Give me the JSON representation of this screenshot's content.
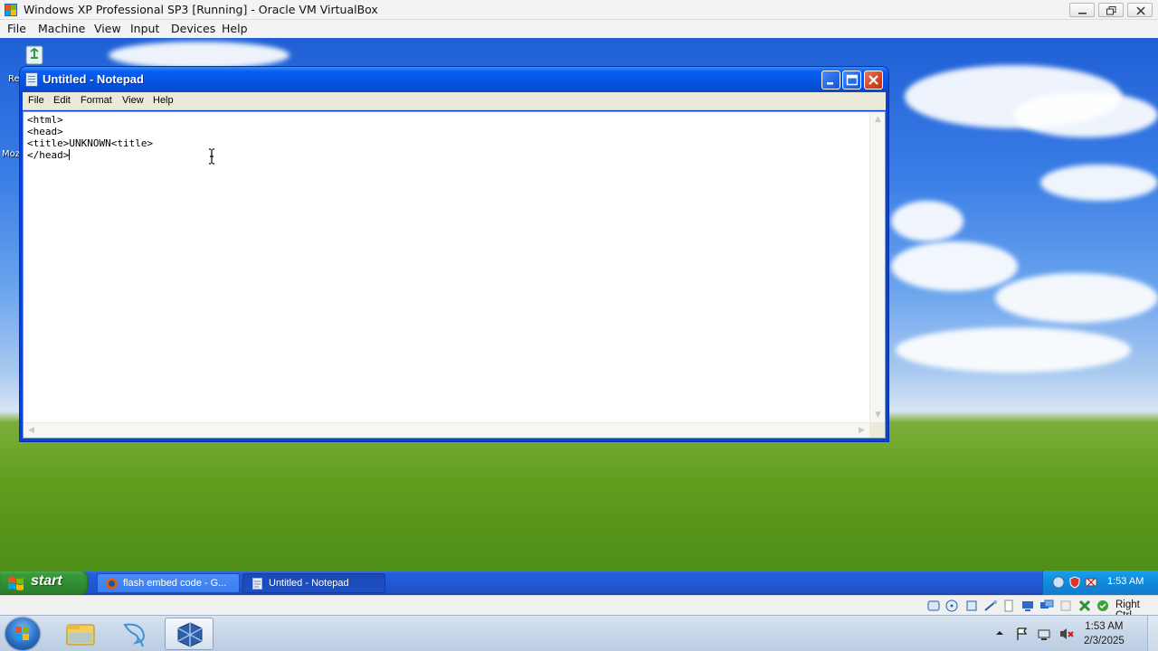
{
  "host_window": {
    "title": "Windows XP Professional SP3 [Running] - Oracle VM VirtualBox",
    "menu": [
      "File",
      "Machine",
      "View",
      "Input",
      "Devices",
      "Help"
    ],
    "status_bar": {
      "host_key_label": "Right Ctrl",
      "icons": [
        "hard-disk-icon",
        "optical-drive-icon",
        "audio-icon",
        "network-icon",
        "usb-icon",
        "shared-folders-icon",
        "display-icon",
        "video-capture-icon",
        "cpu-icon",
        "virtualization-icon",
        "mouse-integration-icon"
      ]
    }
  },
  "guest": {
    "desktop_fragments": [
      "Re",
      "Moz"
    ],
    "notepad": {
      "title": "Untitled - Notepad",
      "menu": [
        "File",
        "Edit",
        "Format",
        "View",
        "Help"
      ],
      "content_lines": [
        "<html>",
        "<head>",
        "<title>UNKNOWN<title>",
        "</head>"
      ]
    },
    "taskbar": {
      "start_label": "start",
      "tasks": [
        {
          "label": "flash embed code - G...",
          "icon": "firefox-icon",
          "active": false
        },
        {
          "label": "Untitled - Notepad",
          "icon": "notepad-icon",
          "active": true
        }
      ],
      "clock": "1:53 AM"
    }
  },
  "host_taskbar": {
    "time": "1:53 AM",
    "date": "2/3/2025",
    "pinned": [
      "windows-explorer-icon",
      "kali-linux-icon",
      "virtualbox-icon"
    ]
  },
  "colors": {
    "xp_titlebar": "#0554e3",
    "xp_close": "#d6431c",
    "xp_start": "#3a9a3a",
    "xp_taskbar": "#245edb"
  }
}
